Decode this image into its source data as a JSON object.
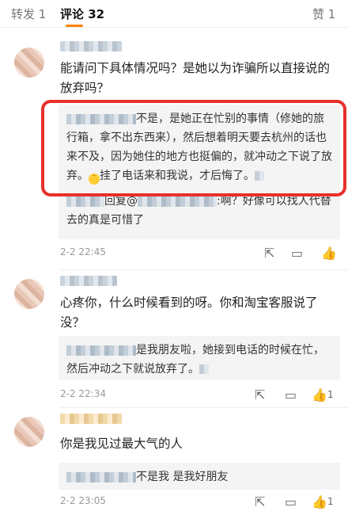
{
  "tabs": {
    "repost": "转发 1",
    "comments": "评论 32",
    "likes": "赞 1"
  },
  "comments": [
    {
      "text": "能请问下具体情况吗？是她以为诈骗所以直接说的放弃吗？",
      "reply_main": "不是，是她正在忙别的事情（修她的旅行箱，拿不出东西来），然后想着明天要去杭州的话也来不及，因为她住的地方也挺偏的，就冲动之下说了放弃。",
      "reply_main_tail": "挂了电话来和我说，才后悔了。",
      "reply_second_prefix": "回复@",
      "reply_second_text": ":啊？好像可以找人代替去的真是可惜了",
      "date": "2-2 22:45"
    },
    {
      "text": "心疼你，什么时候看到的呀。你和淘宝客服说了没？",
      "reply_text": "是我朋友啦，她接到电话的时候在忙，然后冲动之下就说放弃了。",
      "date": "2-2 22:34",
      "like_count": "1"
    },
    {
      "text": "你是我见过最大气的人",
      "reply_text": "不是我 是我好朋友",
      "date": "2-2 23:05",
      "like_count": "1"
    }
  ],
  "icons": {
    "share": "share-icon",
    "comment": "comment-icon",
    "like": "like-icon"
  },
  "colors": {
    "accent": "#ff8200",
    "highlight": "#e8302b"
  }
}
